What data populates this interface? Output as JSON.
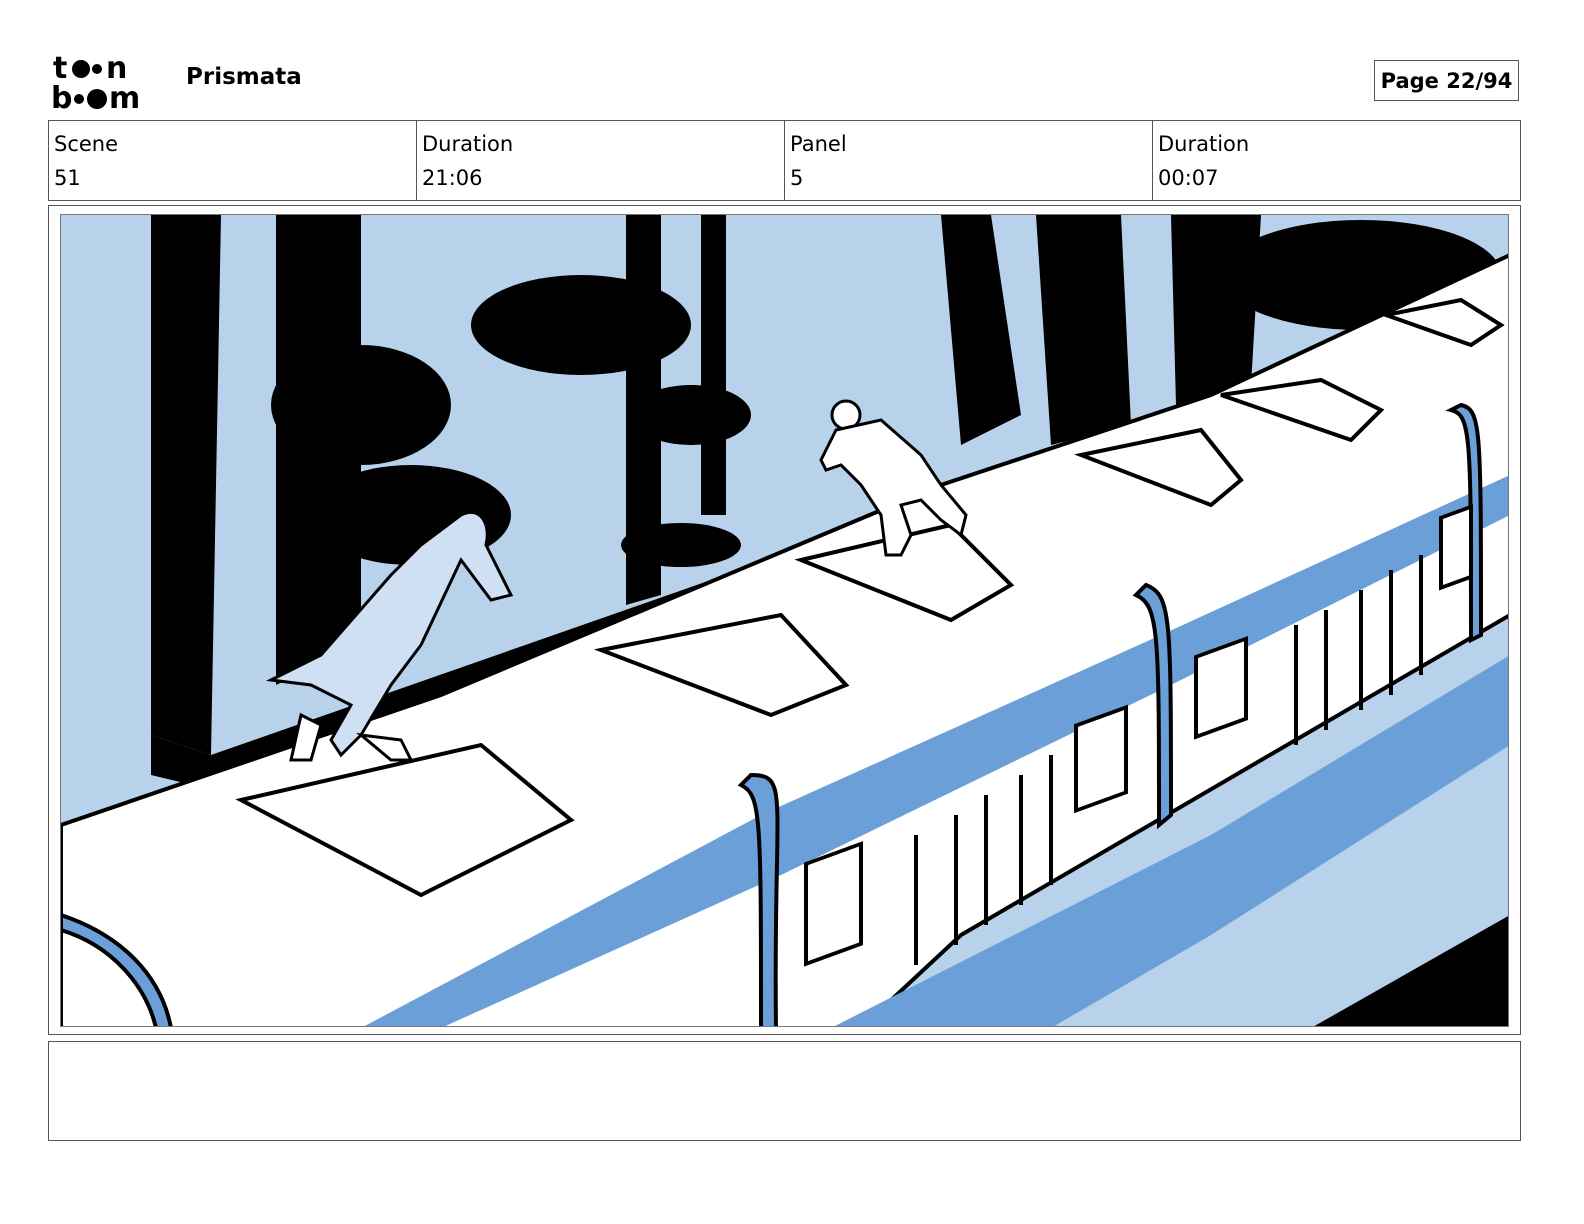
{
  "header": {
    "logo_icon": "toon-boom-logo",
    "project_title": "Prismata",
    "page_label": "Page 22/94"
  },
  "info": {
    "scene_label": "Scene",
    "scene_value": "51",
    "duration_label": "Duration",
    "duration_value": "21:06",
    "panel_label": "Panel",
    "panel_value": "5",
    "panel_duration_label": "Duration",
    "panel_duration_value": "00:07"
  },
  "panel": {
    "image_icon": "storyboard-drawing",
    "notes": ""
  },
  "colors": {
    "sky": "#b9d2ec",
    "shadow_blue": "#6a9fd8",
    "ink": "#000000",
    "paper": "#ffffff"
  }
}
